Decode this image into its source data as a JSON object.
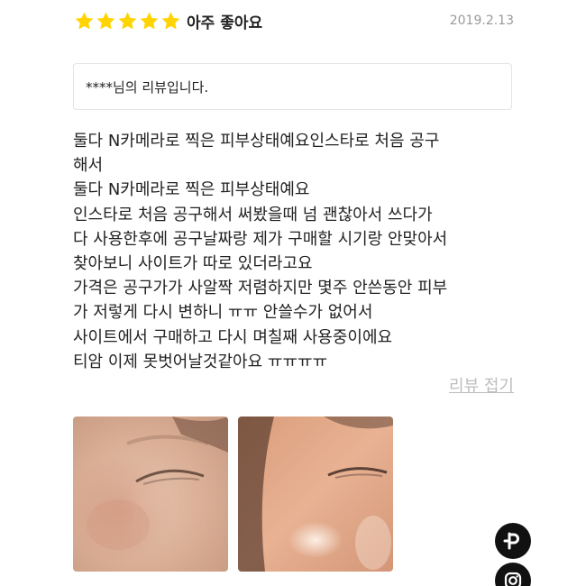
{
  "review": {
    "stars": 5,
    "rating_label": "아주 좋아요",
    "date": "2019.2.13",
    "reviewer_text": "****님의 리뷰입니다.",
    "lines": [
      "둘다 N카메라로 찍은 피부상태예요인스타로 처음 공구",
      "해서",
      "둘다 N카메라로 찍은 피부상태예요",
      "인스타로 처음 공구해서 써봤을때 넘 괜찮아서 쓰다가",
      "다 사용한후에 공구날짜랑 제가 구매할 시기랑 안맞아서",
      "찾아보니 사이트가 따로 있더라고요",
      "가격은 공구가가 사알짝 저렴하지만 몇주 안쓴동안 피부",
      "가 저렇게 다시 변하니 ㅠㅠ 안쓸수가 없어서",
      "사이트에서 구매하고 다시 며칠째 사용중이에요",
      "티암 이제 못벗어날것같아요 ㅠㅠㅠㅠ"
    ],
    "collapse_label": "리뷰 접기"
  },
  "colors": {
    "star": "#FFD400",
    "date": "#999999",
    "collapse": "#BDBDBD",
    "fab": "#111111"
  },
  "icons": {
    "star": "star-icon",
    "fab_top": "p-logo-icon",
    "fab_bottom": "instagram-icon"
  }
}
